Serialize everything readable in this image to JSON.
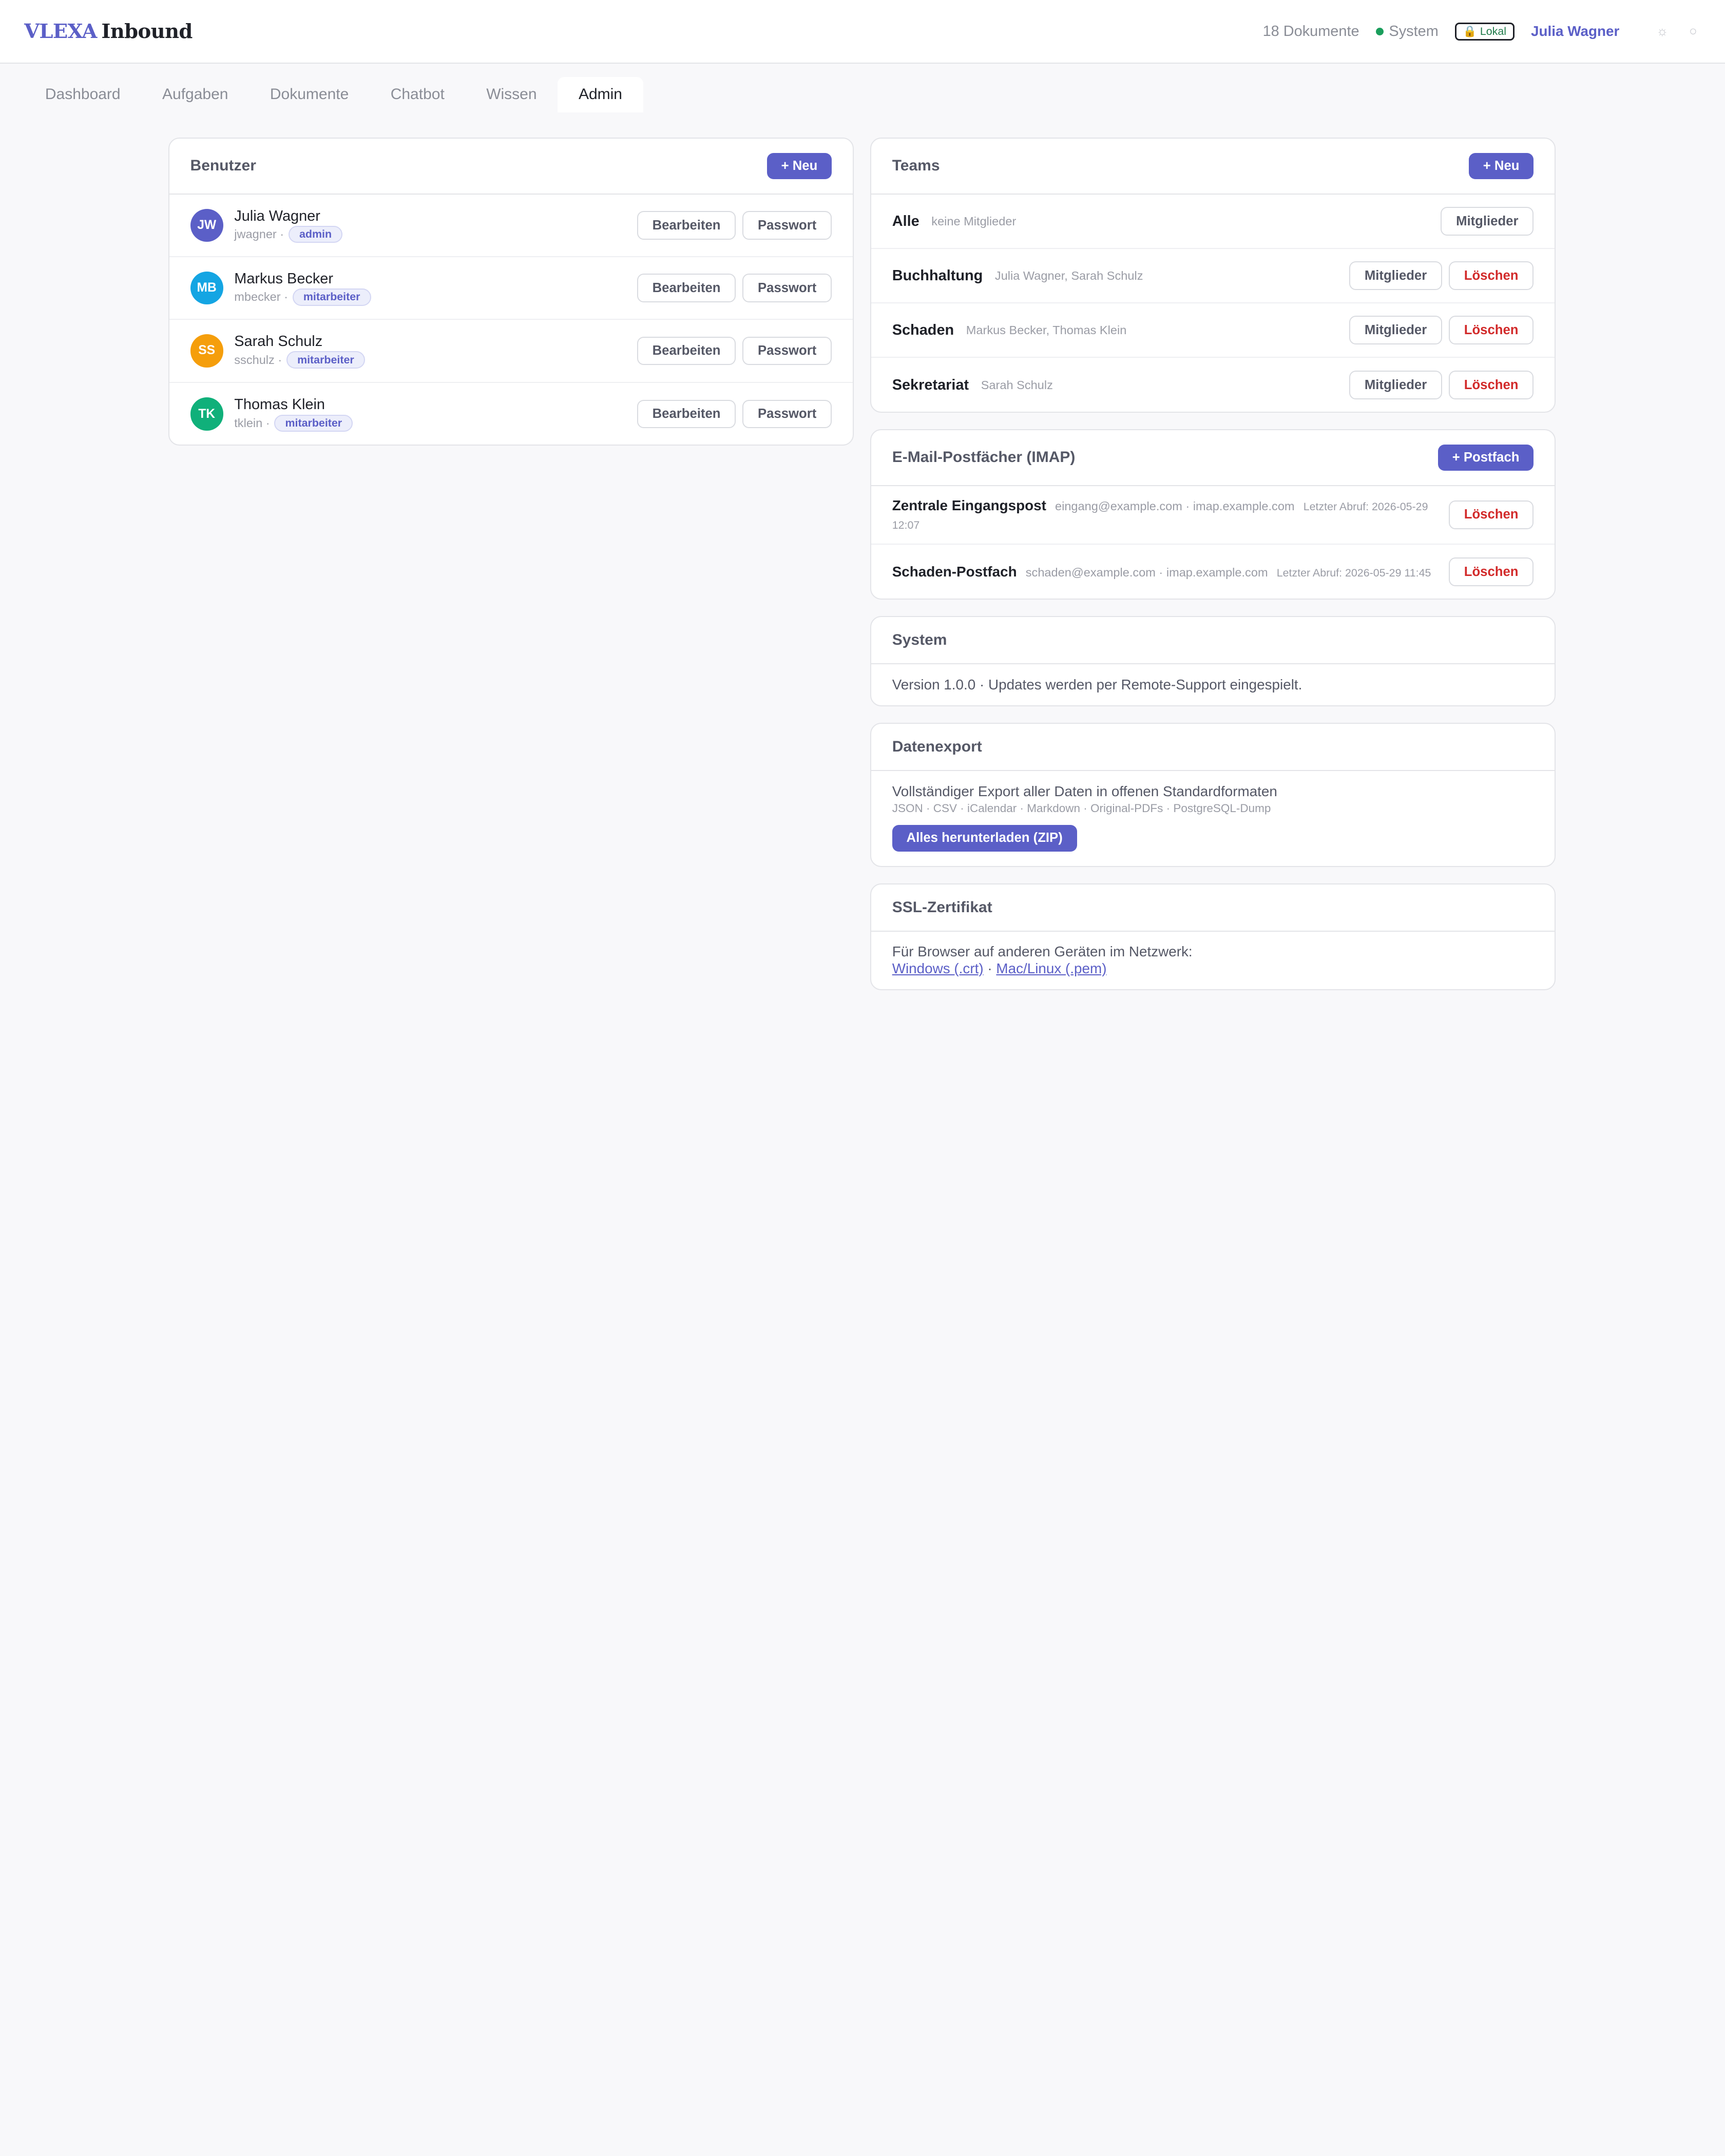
{
  "app": {
    "brand": "VLEXA",
    "product": "Inbound",
    "doc_count": "18 Dokumente",
    "system_status": "System",
    "lokal_badge": "Lokal",
    "user_name": "Julia Wagner"
  },
  "tabs": [
    "Dashboard",
    "Aufgaben",
    "Dokumente",
    "Chatbot",
    "Wissen",
    "Admin"
  ],
  "users": {
    "title": "Benutzer",
    "new_label": "+ Neu",
    "edit_label": "Bearbeiten",
    "password_label": "Passwort",
    "items": [
      {
        "initials": "JW",
        "name": "Julia Wagner",
        "login": "jwagner ·",
        "role": "admin",
        "color": "#5b5fc7"
      },
      {
        "initials": "MB",
        "name": "Markus Becker",
        "login": "mbecker ·",
        "role": "mitarbeiter",
        "color": "#14a5e3"
      },
      {
        "initials": "SS",
        "name": "Sarah Schulz",
        "login": "sschulz ·",
        "role": "mitarbeiter",
        "color": "#f59e0b"
      },
      {
        "initials": "TK",
        "name": "Thomas Klein",
        "login": "tklein ·",
        "role": "mitarbeiter",
        "color": "#10b07a"
      }
    ]
  },
  "teams": {
    "title": "Teams",
    "new_label": "+ Neu",
    "members_label": "Mitglieder",
    "delete_label": "Löschen",
    "items": [
      {
        "name": "Alle",
        "members": "keine Mitglieder"
      },
      {
        "name": "Buchhaltung",
        "members": "Julia Wagner, Sarah Schulz"
      },
      {
        "name": "Schaden",
        "members": "Markus Becker, Thomas Klein"
      },
      {
        "name": "Sekretariat",
        "members": "Sarah Schulz"
      }
    ]
  },
  "mailboxes": {
    "title": "E-Mail-Postfächer (IMAP)",
    "new_label": "+ Postfach",
    "delete_label": "Löschen",
    "items": [
      {
        "name": "Zentrale Eingangspost",
        "meta": "eingang@example.com · imap.example.com",
        "last_fetch": "Letzter Abruf: 2026-05-29 12:07"
      },
      {
        "name": "Schaden-Postfach",
        "meta": "schaden@example.com · imap.example.com",
        "last_fetch": "Letzter Abruf: 2026-05-29 11:45"
      }
    ]
  },
  "system": {
    "title": "System",
    "text": "Version 1.0.0 · Updates werden per Remote-Support eingespielt."
  },
  "export": {
    "title": "Datenexport",
    "text": "Vollständiger Export aller Daten in offenen Standardformaten",
    "formats": "JSON · CSV · iCalendar · Markdown · Original-PDFs · PostgreSQL-Dump",
    "button_label": "Alles herunterladen (ZIP)"
  },
  "ssl": {
    "title": "SSL-Zertifikat",
    "text": "Für Browser auf anderen Geräten im Netzwerk:",
    "windows_link": "Windows (.crt)",
    "separator": "·",
    "mac_link": "Mac/Linux (.pem)"
  },
  "icons": {
    "status_dot_color": "#1a9e5c",
    "lock": "lock-icon",
    "theme": "sun-icon",
    "settings": "circle-icon"
  },
  "colors": {
    "accent": "#5b5fc7",
    "danger": "#d22a2a"
  }
}
